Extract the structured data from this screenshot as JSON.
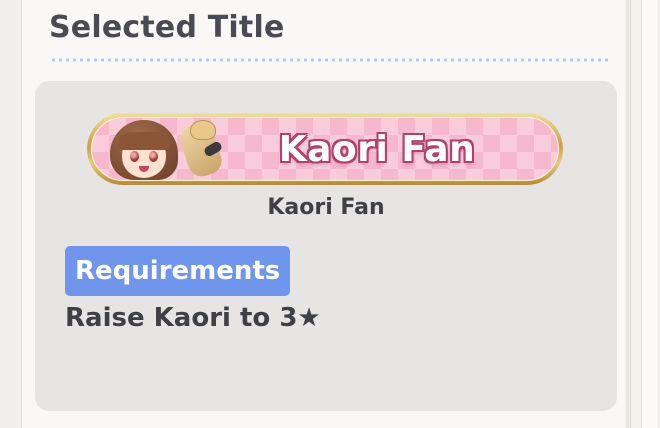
{
  "section": {
    "title": "Selected Title"
  },
  "selected_title": {
    "banner_text": "Kaori Fan",
    "name": "Kaori Fan",
    "portrait_icon": "kaori-portrait-icon"
  },
  "requirements": {
    "label": "Requirements",
    "text": "Raise Kaori to 3★"
  },
  "colors": {
    "accent_blue": "#6f96ec",
    "banner_pink": "#f6b8cf",
    "banner_gold": "#c9a24b",
    "text_dark": "#3f3f46"
  }
}
